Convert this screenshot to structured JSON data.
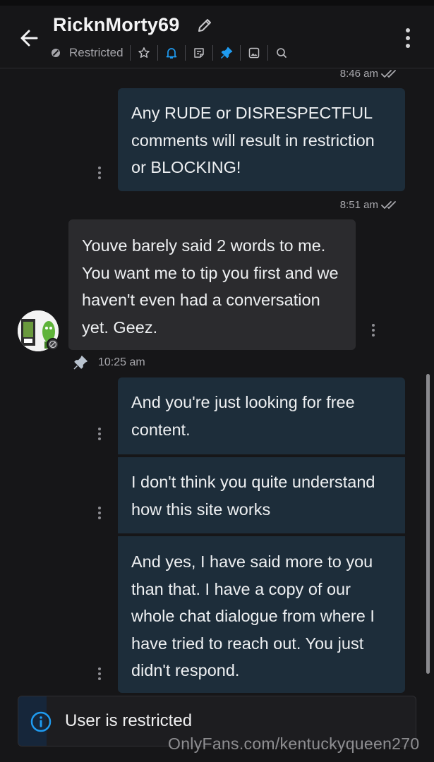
{
  "header": {
    "title": "RicknMorty69",
    "status_label": "Restricted",
    "toolbar_icons": [
      "star-icon",
      "bell-icon",
      "note-icon",
      "pin-icon",
      "image-icon",
      "search-icon"
    ]
  },
  "messages": [
    {
      "direction": "outgoing",
      "time": "8:46 am",
      "text": "Any RUDE or DISRESPECTFUL comments will result in restriction or BLOCKING!"
    },
    {
      "direction": "incoming",
      "time": "8:51 am",
      "text": "Youve barely said 2 words to me. You want me to tip you first and we haven't even had a conversation yet. Geez."
    },
    {
      "direction": "outgoing",
      "time": "10:25 am",
      "text": "And you're just looking for free content."
    },
    {
      "direction": "outgoing",
      "text": "I don't think you quite understand how this site works"
    },
    {
      "direction": "outgoing",
      "text": "And yes, I have said more to you than that. I have a copy of our whole chat dialogue from where I have tried to reach out. You just didn't respond."
    }
  ],
  "banner": {
    "text": "User is restricted"
  },
  "watermark": "OnlyFans.com/kentuckyqueen270",
  "colors": {
    "background": "#161618",
    "outgoing_bubble": "#1d2d3a",
    "incoming_bubble": "#2b2b2e",
    "accent_blue": "#1f9bf0"
  }
}
